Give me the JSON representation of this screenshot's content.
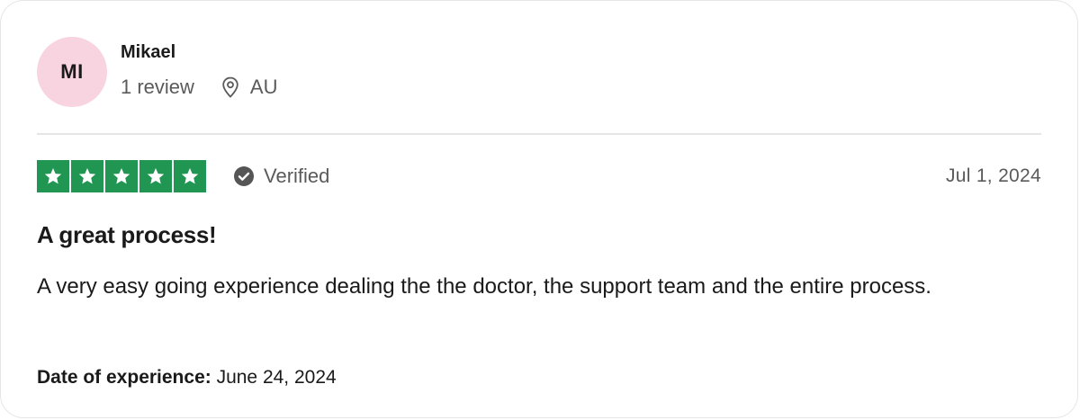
{
  "reviewer": {
    "initials": "MI",
    "name": "Mikael",
    "review_count": "1 review",
    "country": "AU"
  },
  "rating": {
    "stars": 5,
    "max_stars": 5,
    "star_color": "#219653",
    "verified_label": "Verified"
  },
  "review": {
    "date": "Jul 1, 2024",
    "title": "A great process!",
    "body": "A very easy going experience dealing the the doctor, the support team and the entire process.",
    "experience_label": "Date of experience:",
    "experience_date": "June 24, 2024"
  },
  "icons": {
    "location": "location-pin-icon",
    "verified": "check-circle-icon",
    "star": "star-icon"
  }
}
